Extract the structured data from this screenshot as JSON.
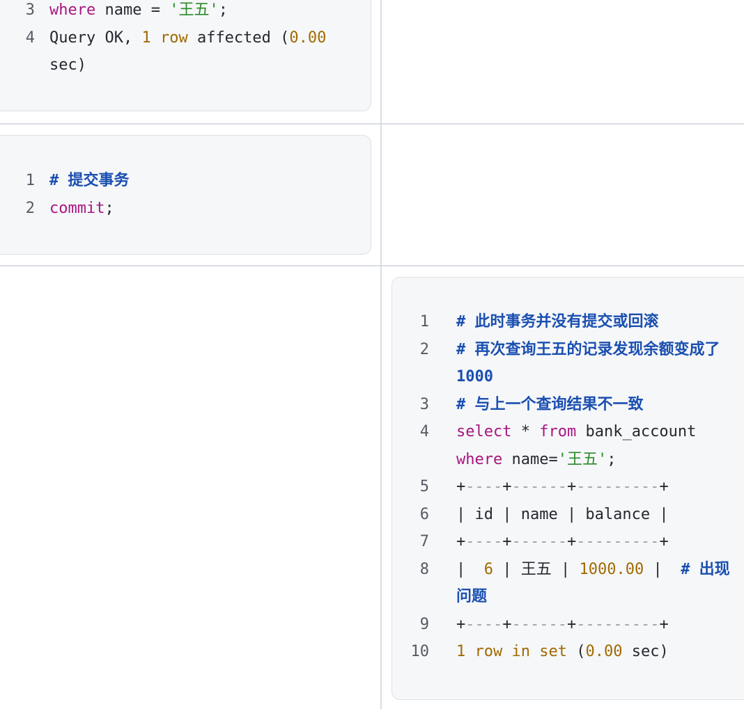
{
  "block1": {
    "lines": [
      {
        "num": "3",
        "parts": [
          {
            "t": "where",
            "c": "kw"
          },
          {
            "t": " name = ",
            "c": "dim"
          },
          {
            "t": "'王五'",
            "c": "str"
          },
          {
            "t": ";",
            "c": "dim"
          }
        ]
      },
      {
        "num": "4",
        "parts": [
          {
            "t": "Query OK, ",
            "c": "dim"
          },
          {
            "t": "1",
            "c": "num"
          },
          {
            "t": " ",
            "c": "dim"
          },
          {
            "t": "row",
            "c": "num"
          },
          {
            "t": " affected (",
            "c": "dim"
          },
          {
            "t": "0.00",
            "c": "num"
          }
        ]
      },
      {
        "num": "",
        "parts": [
          {
            "t": "sec)",
            "c": "dim"
          }
        ]
      }
    ]
  },
  "block2": {
    "lines": [
      {
        "num": "1",
        "parts": [
          {
            "t": "# 提交事务",
            "c": "cmt"
          }
        ]
      },
      {
        "num": "2",
        "parts": [
          {
            "t": "commit",
            "c": "kw"
          },
          {
            "t": ";",
            "c": "dim"
          }
        ]
      }
    ]
  },
  "block3": {
    "lines": [
      {
        "num": "1",
        "parts": [
          {
            "t": "# 此时事务并没有提交或回滚",
            "c": "cmt"
          }
        ]
      },
      {
        "num": "2",
        "parts": [
          {
            "t": "# 再次查询王五的记录发现余额变成了",
            "c": "cmt"
          }
        ]
      },
      {
        "num": "",
        "parts": [
          {
            "t": "1000",
            "c": "cmt"
          }
        ]
      },
      {
        "num": "3",
        "parts": [
          {
            "t": "# 与上一个查询结果不一致",
            "c": "cmt"
          }
        ]
      },
      {
        "num": "4",
        "parts": [
          {
            "t": "select",
            "c": "kw"
          },
          {
            "t": " * ",
            "c": "dim"
          },
          {
            "t": "from",
            "c": "kw"
          },
          {
            "t": " bank_account",
            "c": "dim"
          }
        ]
      },
      {
        "num": "",
        "parts": [
          {
            "t": "where",
            "c": "kw"
          },
          {
            "t": " name=",
            "c": "dim"
          },
          {
            "t": "'王五'",
            "c": "str"
          },
          {
            "t": ";",
            "c": "dim"
          }
        ]
      },
      {
        "num": "5",
        "parts": [
          {
            "t": "+",
            "c": "dim"
          },
          {
            "t": "----",
            "c": "dash"
          },
          {
            "t": "+",
            "c": "dim"
          },
          {
            "t": "------",
            "c": "dash"
          },
          {
            "t": "+",
            "c": "dim"
          },
          {
            "t": "---------",
            "c": "dash"
          },
          {
            "t": "+",
            "c": "dim"
          }
        ]
      },
      {
        "num": "6",
        "parts": [
          {
            "t": "| id | name | balance |",
            "c": "dim"
          }
        ]
      },
      {
        "num": "7",
        "parts": [
          {
            "t": "+",
            "c": "dim"
          },
          {
            "t": "----",
            "c": "dash"
          },
          {
            "t": "+",
            "c": "dim"
          },
          {
            "t": "------",
            "c": "dash"
          },
          {
            "t": "+",
            "c": "dim"
          },
          {
            "t": "---------",
            "c": "dash"
          },
          {
            "t": "+",
            "c": "dim"
          }
        ]
      },
      {
        "num": "8",
        "parts": [
          {
            "t": "|  ",
            "c": "dim"
          },
          {
            "t": "6",
            "c": "num"
          },
          {
            "t": " | 王五 | ",
            "c": "dim"
          },
          {
            "t": "1000.00",
            "c": "num"
          },
          {
            "t": " |  ",
            "c": "dim"
          },
          {
            "t": "# 出现",
            "c": "cmt"
          }
        ]
      },
      {
        "num": "",
        "parts": [
          {
            "t": "问题",
            "c": "cmt"
          }
        ]
      },
      {
        "num": "9",
        "parts": [
          {
            "t": "+",
            "c": "dim"
          },
          {
            "t": "----",
            "c": "dash"
          },
          {
            "t": "+",
            "c": "dim"
          },
          {
            "t": "------",
            "c": "dash"
          },
          {
            "t": "+",
            "c": "dim"
          },
          {
            "t": "---------",
            "c": "dash"
          },
          {
            "t": "+",
            "c": "dim"
          }
        ]
      },
      {
        "num": "10",
        "parts": [
          {
            "t": "1",
            "c": "num"
          },
          {
            "t": " ",
            "c": "dim"
          },
          {
            "t": "row",
            "c": "num"
          },
          {
            "t": " ",
            "c": "dim"
          },
          {
            "t": "in",
            "c": "num"
          },
          {
            "t": " ",
            "c": "dim"
          },
          {
            "t": "set",
            "c": "num"
          },
          {
            "t": " (",
            "c": "dim"
          },
          {
            "t": "0.00",
            "c": "num"
          },
          {
            "t": " sec)",
            "c": "dim"
          }
        ]
      }
    ]
  }
}
